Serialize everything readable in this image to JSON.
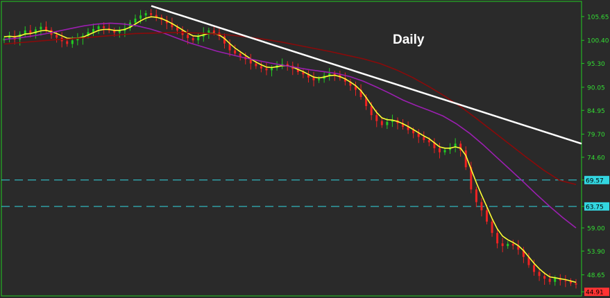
{
  "chart_data": {
    "type": "candlestick",
    "title": "Daily",
    "ylim": [
      44.0,
      109.0
    ],
    "y_ticks": [
      "105.65",
      "100.40",
      "95.30",
      "90.05",
      "84.95",
      "79.70",
      "74.60",
      "69.57",
      "63.75",
      "59.00",
      "53.90",
      "48.65",
      "44.91"
    ],
    "horizontal_levels": [
      {
        "value": 69.57,
        "label": "69.57",
        "color": "#33d6e0"
      },
      {
        "value": 63.75,
        "label": "63.75",
        "color": "#33d6e0"
      }
    ],
    "last_price": {
      "value": 44.91,
      "label": "44.91",
      "color": "#ff3333"
    },
    "closes": [
      100.8,
      101.4,
      100.6,
      101.8,
      102.6,
      101.9,
      102.8,
      103.4,
      102.7,
      101.6,
      101.0,
      100.2,
      99.6,
      100.4,
      100.8,
      101.4,
      102.2,
      102.9,
      103.5,
      103.1,
      102.6,
      102.1,
      102.5,
      103.1,
      104.3,
      105.2,
      105.9,
      106.4,
      106.0,
      105.5,
      104.9,
      104.2,
      103.3,
      102.6,
      101.6,
      100.9,
      100.4,
      101.2,
      102.1,
      102.6,
      102.1,
      101.3,
      99.7,
      98.2,
      97.5,
      96.8,
      96.2,
      95.3,
      94.7,
      94.2,
      93.8,
      94.3,
      94.9,
      95.2,
      94.8,
      94.1,
      93.4,
      92.9,
      92.2,
      91.6,
      91.9,
      92.6,
      93.1,
      92.8,
      92.1,
      91.3,
      90.4,
      89.5,
      87.9,
      85.9,
      83.9,
      82.6,
      81.7,
      82.4,
      82.8,
      82.1,
      81.3,
      80.6,
      79.9,
      79.1,
      78.4,
      77.9,
      76.6,
      75.7,
      76.2,
      76.8,
      77.6,
      76.1,
      72.4,
      67.5,
      64.7,
      62.9,
      60.4,
      57.9,
      55.6,
      55.0,
      55.5,
      55.1,
      54.2,
      52.6,
      50.8,
      49.3,
      48.4,
      47.8,
      47.1,
      47.9,
      47.4,
      47.3,
      46.8,
      46.5
    ],
    "series": [
      {
        "name": "",
        "color": "#ffff33",
        "values": [
          101.2,
          101.3,
          101.2,
          101.4,
          101.8,
          101.9,
          102.2,
          102.5,
          102.6,
          102.3,
          101.9,
          101.4,
          100.9,
          100.8,
          100.9,
          101.1,
          101.6,
          102.1,
          102.6,
          102.8,
          102.8,
          102.6,
          102.6,
          102.8,
          103.3,
          104.0,
          104.7,
          105.3,
          105.6,
          105.5,
          105.2,
          104.7,
          104.1,
          103.4,
          102.7,
          102.0,
          101.4,
          101.3,
          101.6,
          101.9,
          101.9,
          101.6,
          100.8,
          99.7,
          98.7,
          97.9,
          97.1,
          96.3,
          95.6,
          95.0,
          94.5,
          94.4,
          94.6,
          94.8,
          94.8,
          94.5,
          94.0,
          93.5,
          92.9,
          92.3,
          92.1,
          92.3,
          92.6,
          92.7,
          92.4,
          91.9,
          91.2,
          90.4,
          89.3,
          87.8,
          86.1,
          84.5,
          83.3,
          82.9,
          82.8,
          82.5,
          82.0,
          81.4,
          80.7,
          80.0,
          79.3,
          78.7,
          77.8,
          76.9,
          76.6,
          76.6,
          76.9,
          76.6,
          75.0,
          72.0,
          69.0,
          66.3,
          63.7,
          61.1,
          58.8,
          57.2,
          56.4,
          55.8,
          55.1,
          54.0,
          52.6,
          51.2,
          50.0,
          49.0,
          48.2,
          48.0,
          47.8,
          47.6,
          47.3,
          47.0
        ]
      },
      {
        "name": "",
        "color": "#9b1fb0",
        "values": [
          100.6,
          100.9,
          101.3,
          101.8,
          102.4,
          103.0,
          103.6,
          104.0,
          104.2,
          104.0,
          103.6,
          102.9,
          102.0,
          100.9,
          99.8,
          98.9,
          98.0,
          97.3,
          96.6,
          96.0,
          95.4,
          94.9,
          94.4,
          93.9,
          93.5,
          93.1,
          92.4,
          91.4,
          90.1,
          88.7,
          87.2,
          86.0,
          84.9,
          83.7,
          82.0,
          79.9,
          77.4,
          74.7,
          72.0,
          69.3,
          66.5,
          63.8,
          61.3,
          59.0
        ]
      },
      {
        "name": "",
        "color": "#8b0a0a",
        "values": [
          99.6,
          99.9,
          100.2,
          100.5,
          100.7,
          101.0,
          101.3,
          101.6,
          101.9,
          102.0,
          102.1,
          102.1,
          102.0,
          101.8,
          101.5,
          101.1,
          100.6,
          100.0,
          99.3,
          98.6,
          97.9,
          97.1,
          96.3,
          95.3,
          93.9,
          92.2,
          90.2,
          88.0,
          85.6,
          82.9,
          80.1,
          77.3,
          74.5,
          71.8,
          69.5,
          68.6
        ]
      },
      {
        "name": "",
        "color": "#ffffff",
        "type": "trendline",
        "values": [
          108.0,
          77.6
        ]
      }
    ]
  }
}
